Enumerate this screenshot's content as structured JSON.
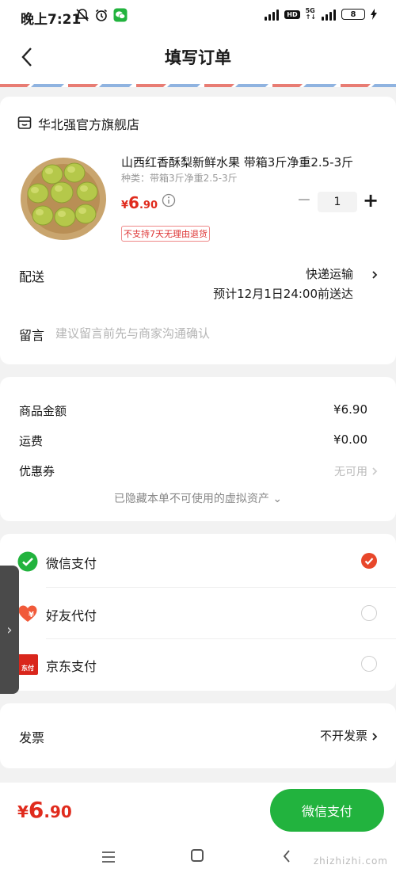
{
  "status_bar": {
    "time": "晚上7:21",
    "network": "5G",
    "hd": "HD",
    "battery": "8"
  },
  "nav": {
    "title": "填写订单"
  },
  "shop": {
    "name": "华北强官方旗舰店"
  },
  "product": {
    "title": "山西红香酥梨新鲜水果 带箱3斤净重2.5-3斤",
    "spec": "种类：带箱3斤净重2.5-3斤",
    "price_symbol": "¥",
    "price_int": "6",
    "price_dec": ".90",
    "quantity": "1",
    "return_tag": "不支持7天无理由退货"
  },
  "delivery": {
    "label": "配送",
    "method": "快递运输",
    "eta": "预计12月1日24:00前送达"
  },
  "message": {
    "label": "留言",
    "placeholder": "建议留言前先与商家沟通确认"
  },
  "amounts": {
    "goods_label": "商品金额",
    "goods_value": "¥6.90",
    "shipping_label": "运费",
    "shipping_value": "¥0.00",
    "coupon_label": "优惠券",
    "coupon_value": "无可用",
    "hidden_assets": "已隐藏本单不可使用的虚拟资产 ⌄"
  },
  "payment": {
    "options": [
      {
        "label": "微信支付",
        "selected": true
      },
      {
        "label": "好友代付",
        "selected": false
      },
      {
        "label": "京东支付",
        "selected": false
      }
    ],
    "jd_icon_text": "东付"
  },
  "invoice": {
    "label": "发票",
    "value": "不开发票"
  },
  "bottom": {
    "total_symbol": "¥",
    "total_int": "6",
    "total_dec": ".90",
    "pay_button": "微信支付",
    "watermark": "zhizhizhi.com"
  },
  "colors": {
    "price_red": "#e02b1d",
    "wechat_green": "#22b33e",
    "check_orange": "#e8472a"
  }
}
